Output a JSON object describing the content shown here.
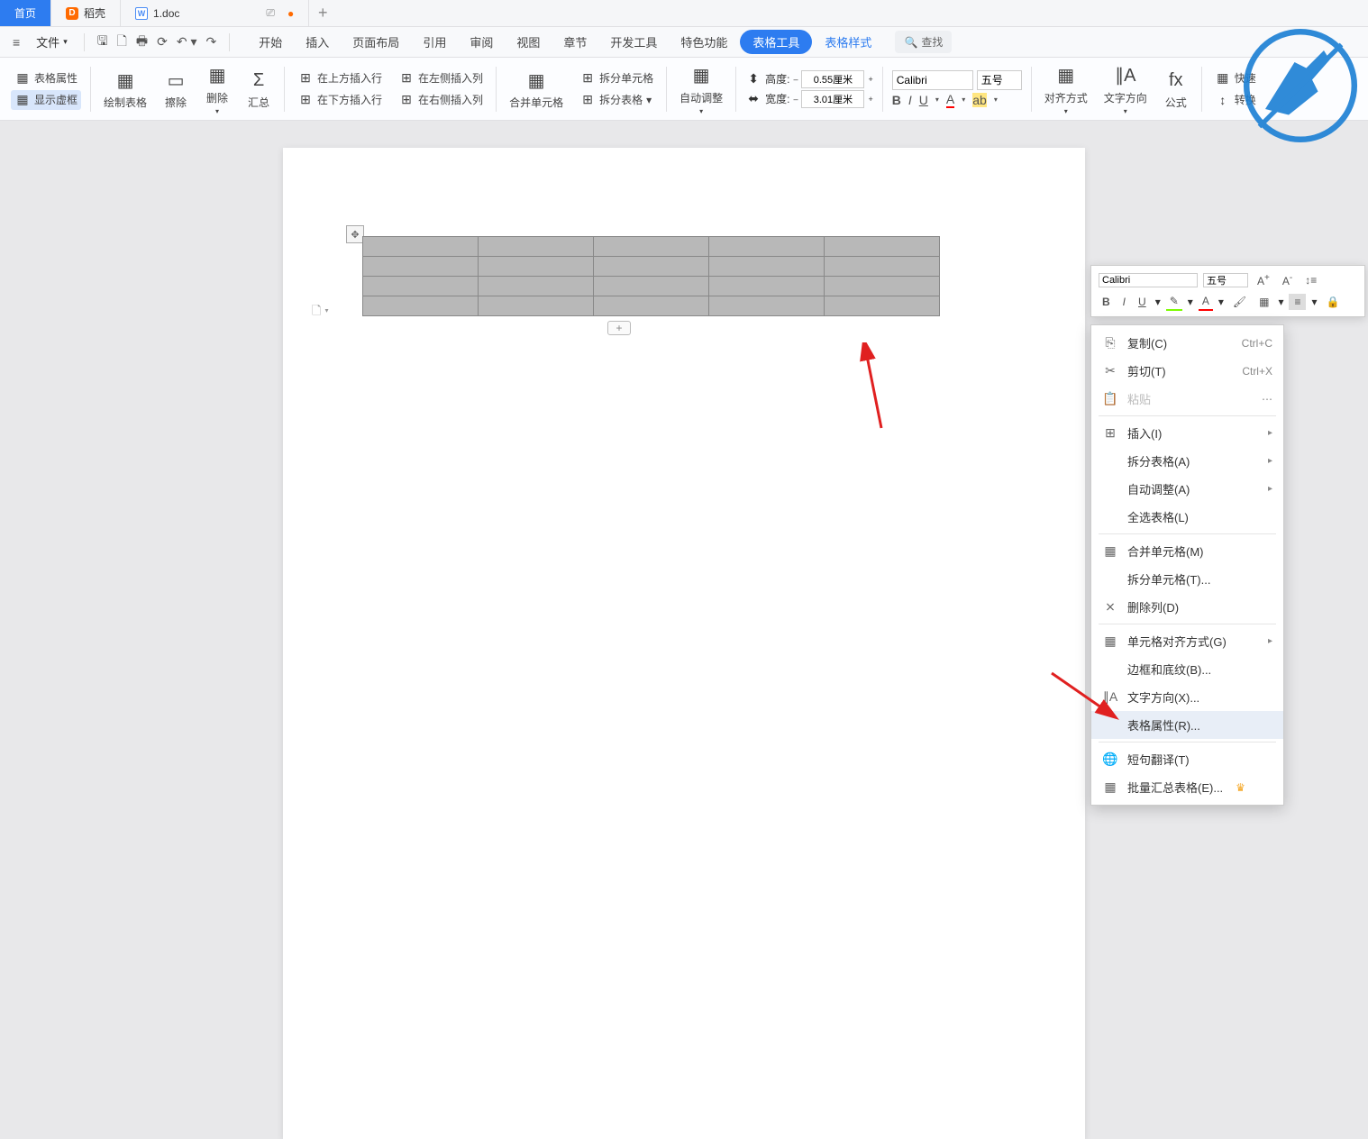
{
  "tabs": {
    "home": "首页",
    "daoke": "稻壳",
    "doc": "1.doc",
    "add": "+"
  },
  "menu": {
    "file": "文件",
    "tabs": [
      "开始",
      "插入",
      "页面布局",
      "引用",
      "审阅",
      "视图",
      "章节",
      "开发工具",
      "特色功能"
    ],
    "table_tools": "表格工具",
    "table_style": "表格样式",
    "search": "查找"
  },
  "ribbon": {
    "table_props": "表格属性",
    "show_border": "显示虚框",
    "draw_table": "绘制表格",
    "erase": "擦除",
    "delete": "删除",
    "sum": "汇总",
    "insert_above": "在上方插入行",
    "insert_below": "在下方插入行",
    "insert_left": "在左侧插入列",
    "insert_right": "在右侧插入列",
    "merge": "合并单元格",
    "split_cell": "拆分单元格",
    "split_table": "拆分表格",
    "auto_fit": "自动调整",
    "height": "高度:",
    "width": "宽度:",
    "height_val": "0.55厘米",
    "width_val": "3.01厘米",
    "font": "Calibri",
    "size": "五号",
    "align": "对齐方式",
    "text_dir": "文字方向",
    "formula": "公式",
    "quick": "快速",
    "convert": "转换"
  },
  "minitb": {
    "font": "Calibri",
    "size": "五号"
  },
  "ctx": {
    "copy": "复制(C)",
    "copy_sc": "Ctrl+C",
    "cut": "剪切(T)",
    "cut_sc": "Ctrl+X",
    "paste": "粘贴",
    "insert": "插入(I)",
    "split_table": "拆分表格(A)",
    "auto_fit": "自动调整(A)",
    "select_all": "全选表格(L)",
    "merge": "合并单元格(M)",
    "split_cell": "拆分单元格(T)...",
    "del_col": "删除列(D)",
    "cell_align": "单元格对齐方式(G)",
    "border": "边框和底纹(B)...",
    "text_dir": "文字方向(X)...",
    "table_props": "表格属性(R)...",
    "translate": "短句翻译(T)",
    "summary": "批量汇总表格(E)..."
  },
  "doc": {
    "rows": 4,
    "cols": 5
  }
}
